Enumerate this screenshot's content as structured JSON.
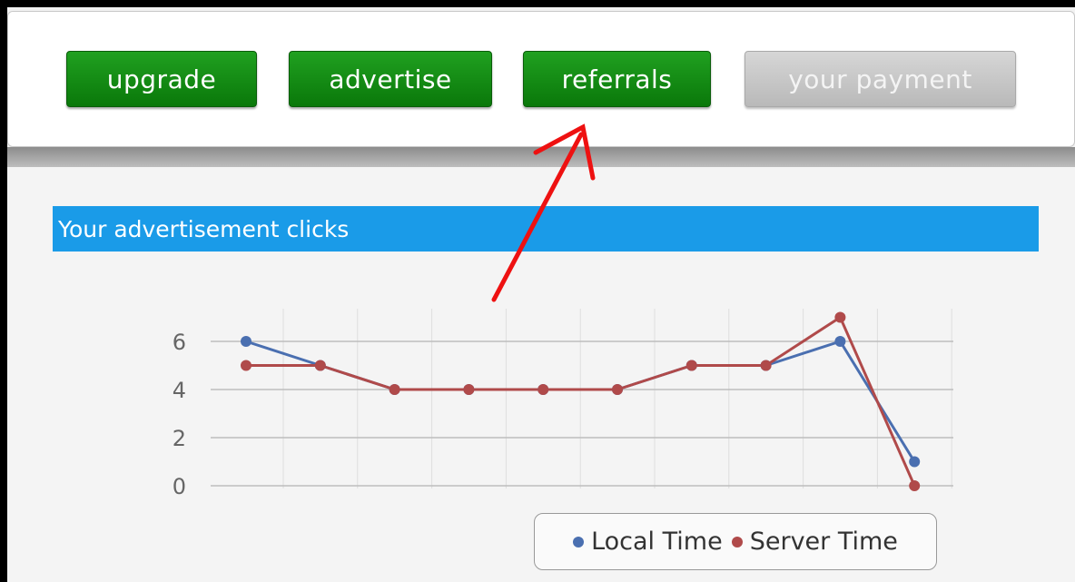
{
  "nav": {
    "buttons": [
      {
        "label": "upgrade",
        "style": "green"
      },
      {
        "label": "advertise",
        "style": "green"
      },
      {
        "label": "referrals",
        "style": "green"
      },
      {
        "label": "your payment",
        "style": "grey"
      }
    ]
  },
  "section": {
    "title": "Your advertisement clicks"
  },
  "annotation": {
    "icon": "red-arrow-icon",
    "color": "#ee1111",
    "points_to": "referrals"
  },
  "colors": {
    "green_button": "#109010",
    "header_blue": "#1a9be8",
    "local_series": "#4a6fb0",
    "server_series": "#b04a4a"
  },
  "chart_data": {
    "type": "line",
    "x": [
      1,
      2,
      3,
      4,
      5,
      6,
      7,
      8,
      9,
      10
    ],
    "y_ticks": [
      "0",
      "2",
      "4",
      "6"
    ],
    "ylim": [
      0,
      6
    ],
    "grid": true,
    "legend_position": "bottom-right",
    "series": [
      {
        "name": "Local Time",
        "color": "#4a6fb0",
        "values": [
          6,
          5,
          4,
          4,
          4,
          4,
          5,
          5,
          6,
          1
        ]
      },
      {
        "name": "Server Time",
        "color": "#b04a4a",
        "values": [
          5,
          5,
          4,
          4,
          4,
          4,
          5,
          5,
          7,
          0
        ]
      }
    ]
  }
}
